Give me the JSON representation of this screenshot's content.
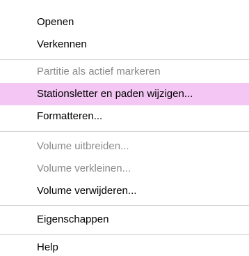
{
  "colors": {
    "highlight": "#f3c6f3",
    "text": "#000000",
    "disabled_text": "#8a8a8a",
    "separator": "#d4d4d4"
  },
  "menu": {
    "items": [
      {
        "label": "Openen",
        "disabled": false,
        "highlighted": false
      },
      {
        "label": "Verkennen",
        "disabled": false,
        "highlighted": false
      },
      {
        "label": "Partitie als actief markeren",
        "disabled": true,
        "highlighted": false
      },
      {
        "label": "Stationsletter en paden wijzigen...",
        "disabled": false,
        "highlighted": true
      },
      {
        "label": "Formatteren...",
        "disabled": false,
        "highlighted": false
      },
      {
        "label": "Volume uitbreiden...",
        "disabled": true,
        "highlighted": false
      },
      {
        "label": "Volume verkleinen...",
        "disabled": true,
        "highlighted": false
      },
      {
        "label": "Volume verwijderen...",
        "disabled": false,
        "highlighted": false
      },
      {
        "label": "Eigenschappen",
        "disabled": false,
        "highlighted": false
      },
      {
        "label": "Help",
        "disabled": false,
        "highlighted": false
      }
    ]
  }
}
